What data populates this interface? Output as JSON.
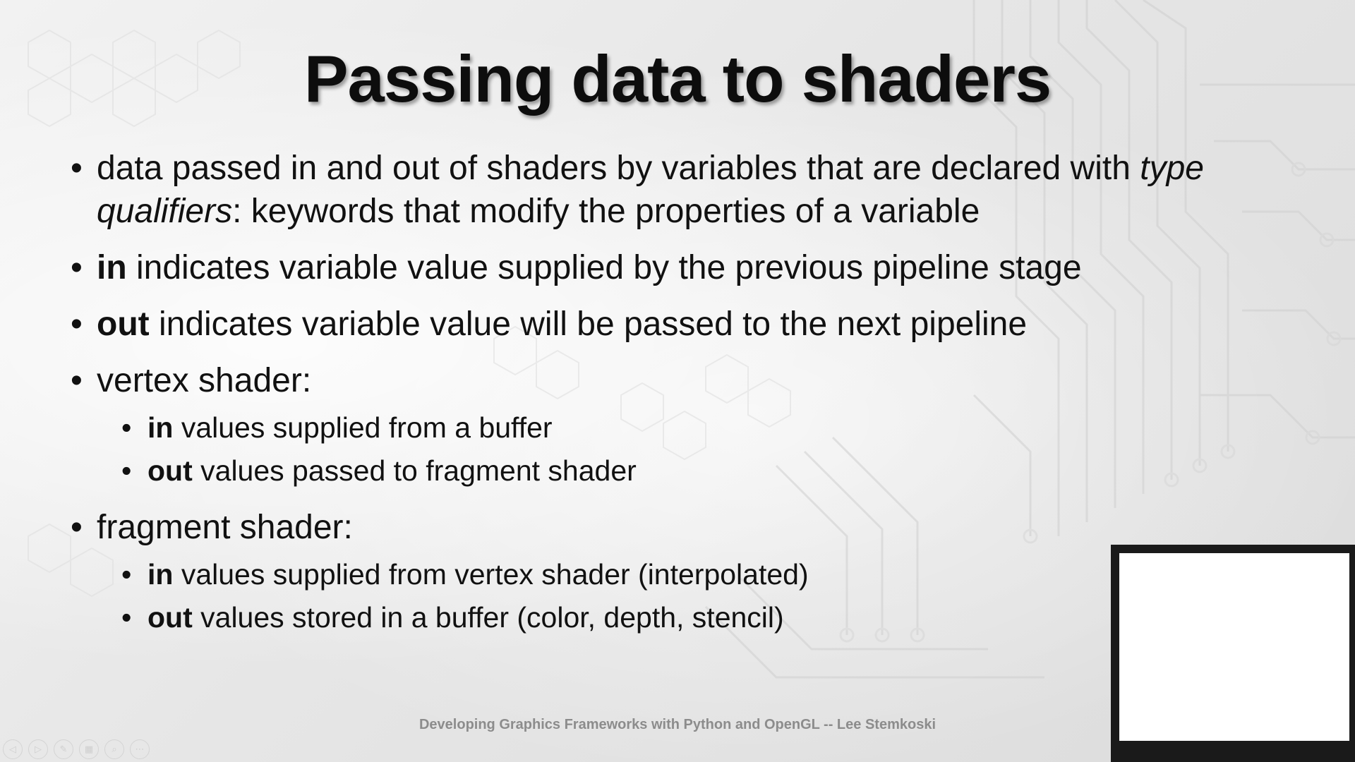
{
  "slide": {
    "title": "Passing data to shaders",
    "bullets": [
      {
        "pre": "data passed in and out of shaders by variables that are declared with ",
        "em": "type qualifiers",
        "post": ": keywords that modify the properties of a variable"
      },
      {
        "bold": "in",
        "text": " indicates variable value supplied by the previous pipeline stage"
      },
      {
        "bold": "out",
        "text": " indicates variable value will be passed to the next pipeline"
      },
      {
        "text": "vertex shader:",
        "sub": [
          {
            "bold": "in",
            "text": " values supplied from a buffer"
          },
          {
            "bold": "out",
            "text": " values passed to fragment shader"
          }
        ]
      },
      {
        "text": "fragment shader:",
        "sub": [
          {
            "bold": "in",
            "text": " values supplied from vertex shader (interpolated)"
          },
          {
            "bold": "out",
            "text": " values stored in a buffer (color, depth, stencil)"
          }
        ]
      }
    ],
    "footer": "Developing Graphics Frameworks with Python and OpenGL -- Lee Stemkoski"
  },
  "controls": [
    {
      "icon": "previous-icon",
      "glyph": "◁"
    },
    {
      "icon": "next-icon",
      "glyph": "▷"
    },
    {
      "icon": "pen-icon",
      "glyph": "✎"
    },
    {
      "icon": "slides-icon",
      "glyph": "▦"
    },
    {
      "icon": "zoom-icon",
      "glyph": "⌕"
    },
    {
      "icon": "more-icon",
      "glyph": "⋯"
    }
  ]
}
